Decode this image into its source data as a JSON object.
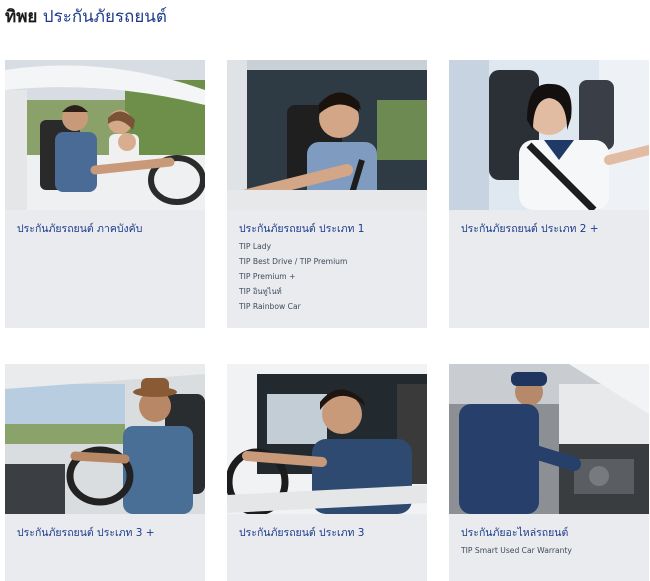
{
  "header": {
    "brand": "ทิพย",
    "title": "ประกันภัยรถยนต์"
  },
  "cards": [
    {
      "title": "ประกันภัยรถยนต์ ภาคบังคับ",
      "items": []
    },
    {
      "title": "ประกันภัยรถยนต์ ประเภท 1",
      "items": [
        "TIP Lady",
        "TIP Best Drive / TIP Premium",
        "TIP Premium +",
        "TIP อินทูไนท์",
        "TIP Rainbow Car"
      ]
    },
    {
      "title": "ประกันภัยรถยนต์ ประเภท 2 +",
      "items": []
    },
    {
      "title": "ประกันภัยรถยนต์ ประเภท 3 +",
      "items": []
    },
    {
      "title": "ประกันภัยรถยนต์ ประเภท 3",
      "items": []
    },
    {
      "title": "ประกันภัยอะไหล่รถยนต์",
      "items": [
        "TIP Smart Used Car Warranty"
      ]
    }
  ],
  "colors": {
    "title_blue": "#1d3b8c",
    "card_background": "#e9ebee"
  },
  "images": [
    "family-in-car-photo",
    "man-driving-photo",
    "woman-driver-photo",
    "man-with-hat-driving-photo",
    "young-man-driving-photo",
    "mechanic-engine-photo"
  ]
}
